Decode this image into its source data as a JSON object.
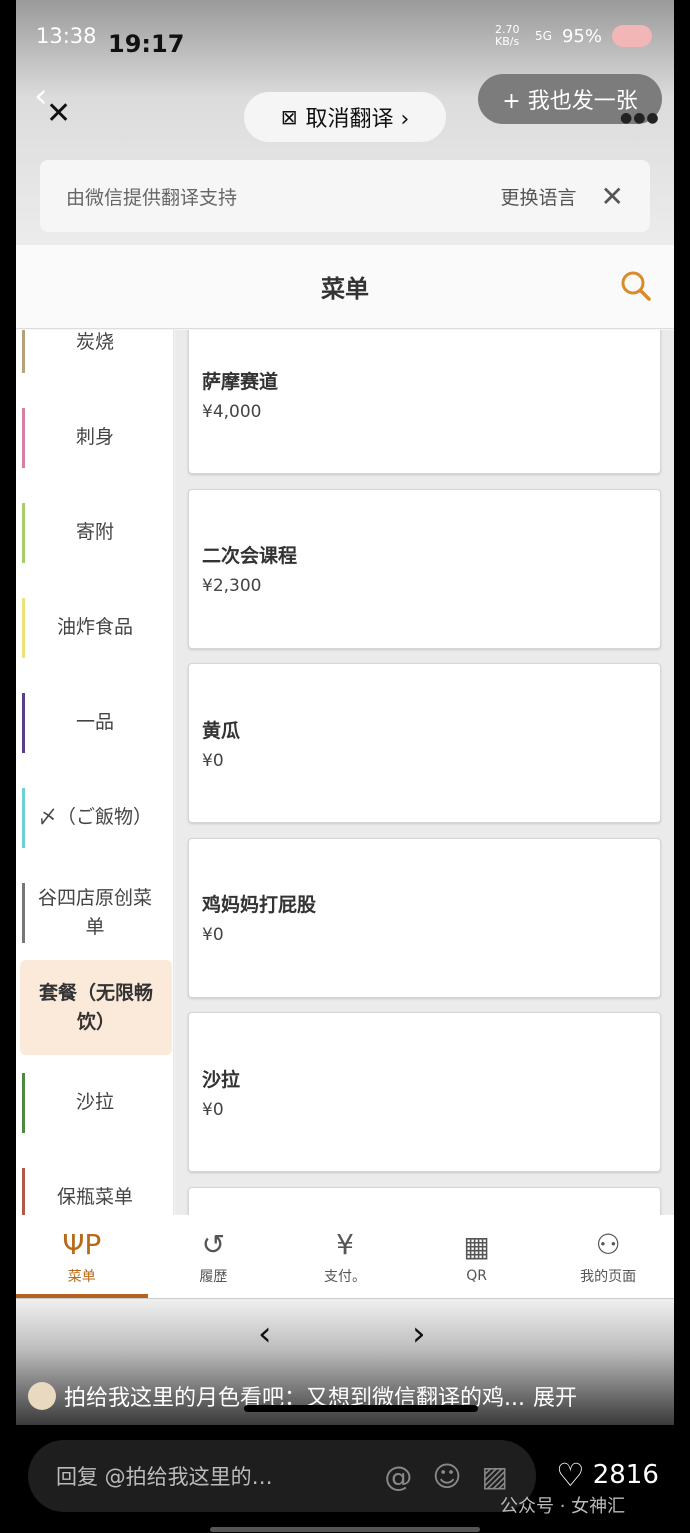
{
  "status": {
    "time_bg": "13:38",
    "time_fg": "19:17",
    "speed": "2.70 KB/s",
    "network": "5G",
    "battery": "95%"
  },
  "top": {
    "untranslate": "取消翻译 ›",
    "post": "+ 我也发一张"
  },
  "banner": {
    "text": "由微信提供翻译支持",
    "change": "更换语言",
    "close": "✕"
  },
  "header": {
    "title": "菜单"
  },
  "sidebar": {
    "items": [
      {
        "label": "炭烧",
        "color": "#b8a07a"
      },
      {
        "label": "刺身",
        "color": "#d67fa3"
      },
      {
        "label": "寄附",
        "color": "#a9cc6a"
      },
      {
        "label": "油炸食品",
        "color": "#ede27a"
      },
      {
        "label": "一品",
        "color": "#5b3f8a"
      },
      {
        "label": "〆（ご飯物）",
        "color": "#6fcfd6"
      },
      {
        "label": "谷四店原创菜单",
        "color": "#777777"
      },
      {
        "label": "套餐（无限畅饮）",
        "selected": true
      },
      {
        "label": "沙拉",
        "color": "#4e8a3e"
      },
      {
        "label": "保瓶菜单",
        "color": "#b4574a"
      }
    ]
  },
  "menu": {
    "items": [
      {
        "name": "萨摩赛道",
        "price": "¥4,000"
      },
      {
        "name": "二次会课程",
        "price": "¥2,300"
      },
      {
        "name": "黄瓜",
        "price": "¥0"
      },
      {
        "name": "鸡妈妈打屁股",
        "price": "¥0"
      },
      {
        "name": "沙拉",
        "price": "¥0"
      },
      {
        "name": "",
        "price": ""
      }
    ]
  },
  "tabs": [
    {
      "label": "菜单",
      "icon": "fork-spoon-icon",
      "active": true
    },
    {
      "label": "履歴",
      "icon": "history-icon"
    },
    {
      "label": "支付。",
      "icon": "yen-icon"
    },
    {
      "label": "QR",
      "icon": "qr-icon"
    },
    {
      "label": "我的页面",
      "icon": "user-icon"
    }
  ],
  "post_caption": {
    "text": "拍给我这里的月色看吧：又想到微信翻译的鸡...",
    "expand": "展开"
  },
  "reply": {
    "placeholder": "回复 @拍给我这里的…",
    "likes": "2816"
  },
  "watermark": "公众号 · 女神汇",
  "accent": "#b5621f"
}
